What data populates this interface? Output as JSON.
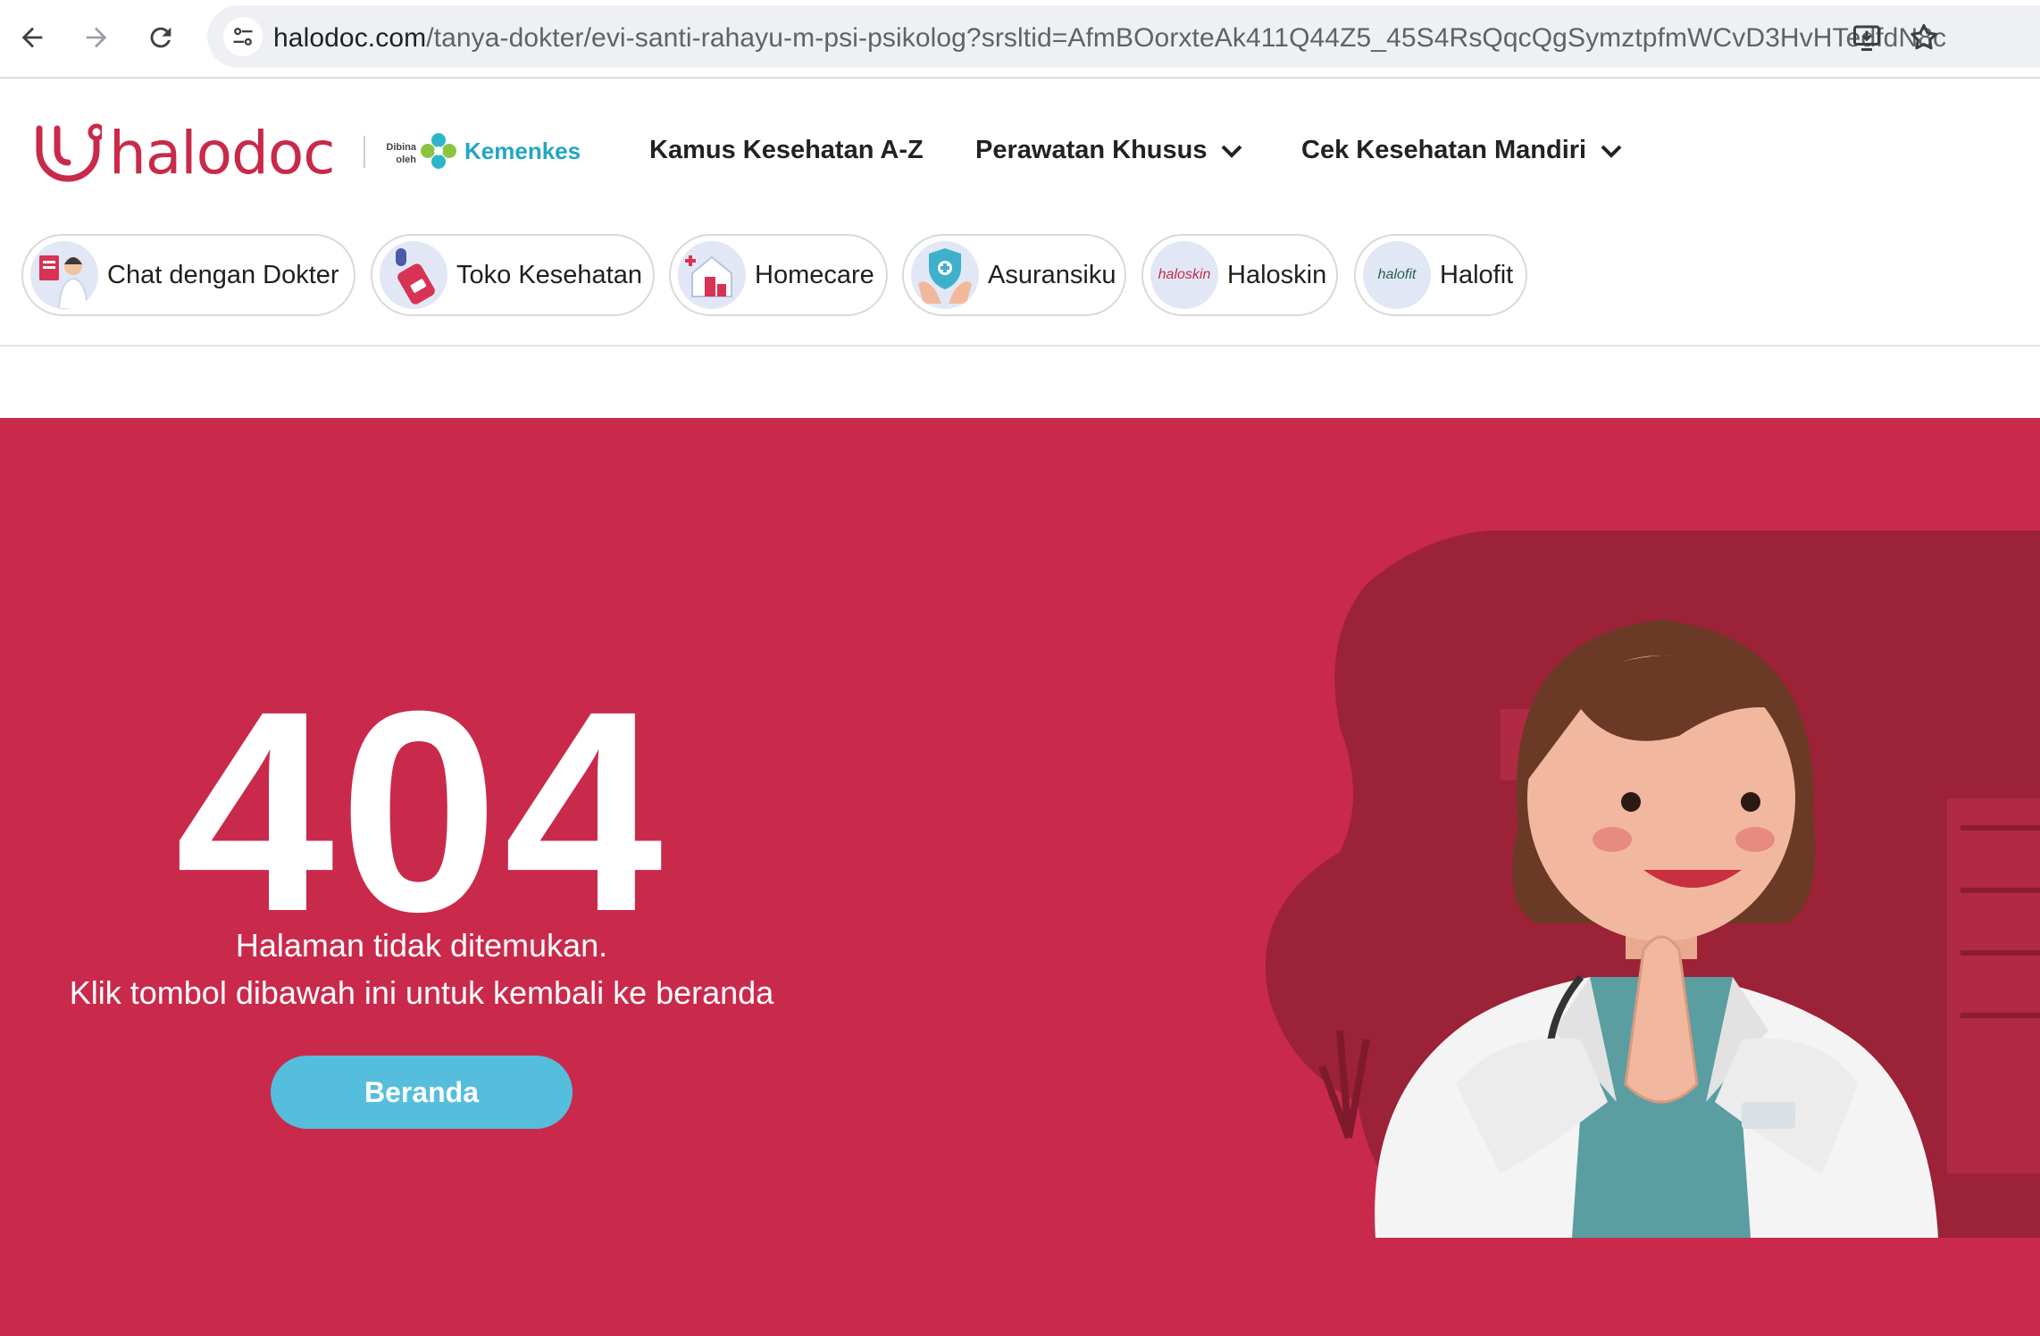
{
  "browser": {
    "url_host": "halodoc.com",
    "url_path": "/tanya-dokter/evi-santi-rahayu-m-psi-psikolog?srsltid=AfmBOorxteAk411Q44Z5_45S4RsQqcQgSymztpfmWCvD3HvHTedfdN8c",
    "icons": [
      "back-icon",
      "forward-icon",
      "reload-icon",
      "site-info-icon",
      "install-app-icon",
      "bookmark-star-icon"
    ]
  },
  "header": {
    "logo_text": "halodoc",
    "dibina_line1": "Dibina",
    "dibina_line2": "oleh",
    "partner": "Kemenkes",
    "nav": [
      {
        "label": "Kamus Kesehatan A-Z",
        "has_dropdown": false
      },
      {
        "label": "Perawatan Khusus",
        "has_dropdown": true
      },
      {
        "label": "Cek Kesehatan Mandiri",
        "has_dropdown": true
      }
    ]
  },
  "categories": [
    {
      "label": "Chat dengan Dokter",
      "icon": "doctor-chat-icon"
    },
    {
      "label": "Toko Kesehatan",
      "icon": "medicine-store-icon"
    },
    {
      "label": "Homecare",
      "icon": "homecare-icon"
    },
    {
      "label": "Asuransiku",
      "icon": "insurance-shield-icon"
    },
    {
      "label": "Haloskin",
      "icon": "haloskin-logo-icon",
      "icon_text": "haloskin"
    },
    {
      "label": "Halofit",
      "icon": "halofit-logo-icon",
      "icon_text": "halofit"
    }
  ],
  "error": {
    "code": "404",
    "line1": "Halaman tidak ditemukan.",
    "line2": "Klik tombol dibawah ini untuk kembali ke beranda",
    "button": "Beranda"
  },
  "colors": {
    "brand": "#c92a4a",
    "hero_bg": "#c92a4c",
    "button": "#55bedc",
    "kemenkes": "#21a6c2"
  }
}
